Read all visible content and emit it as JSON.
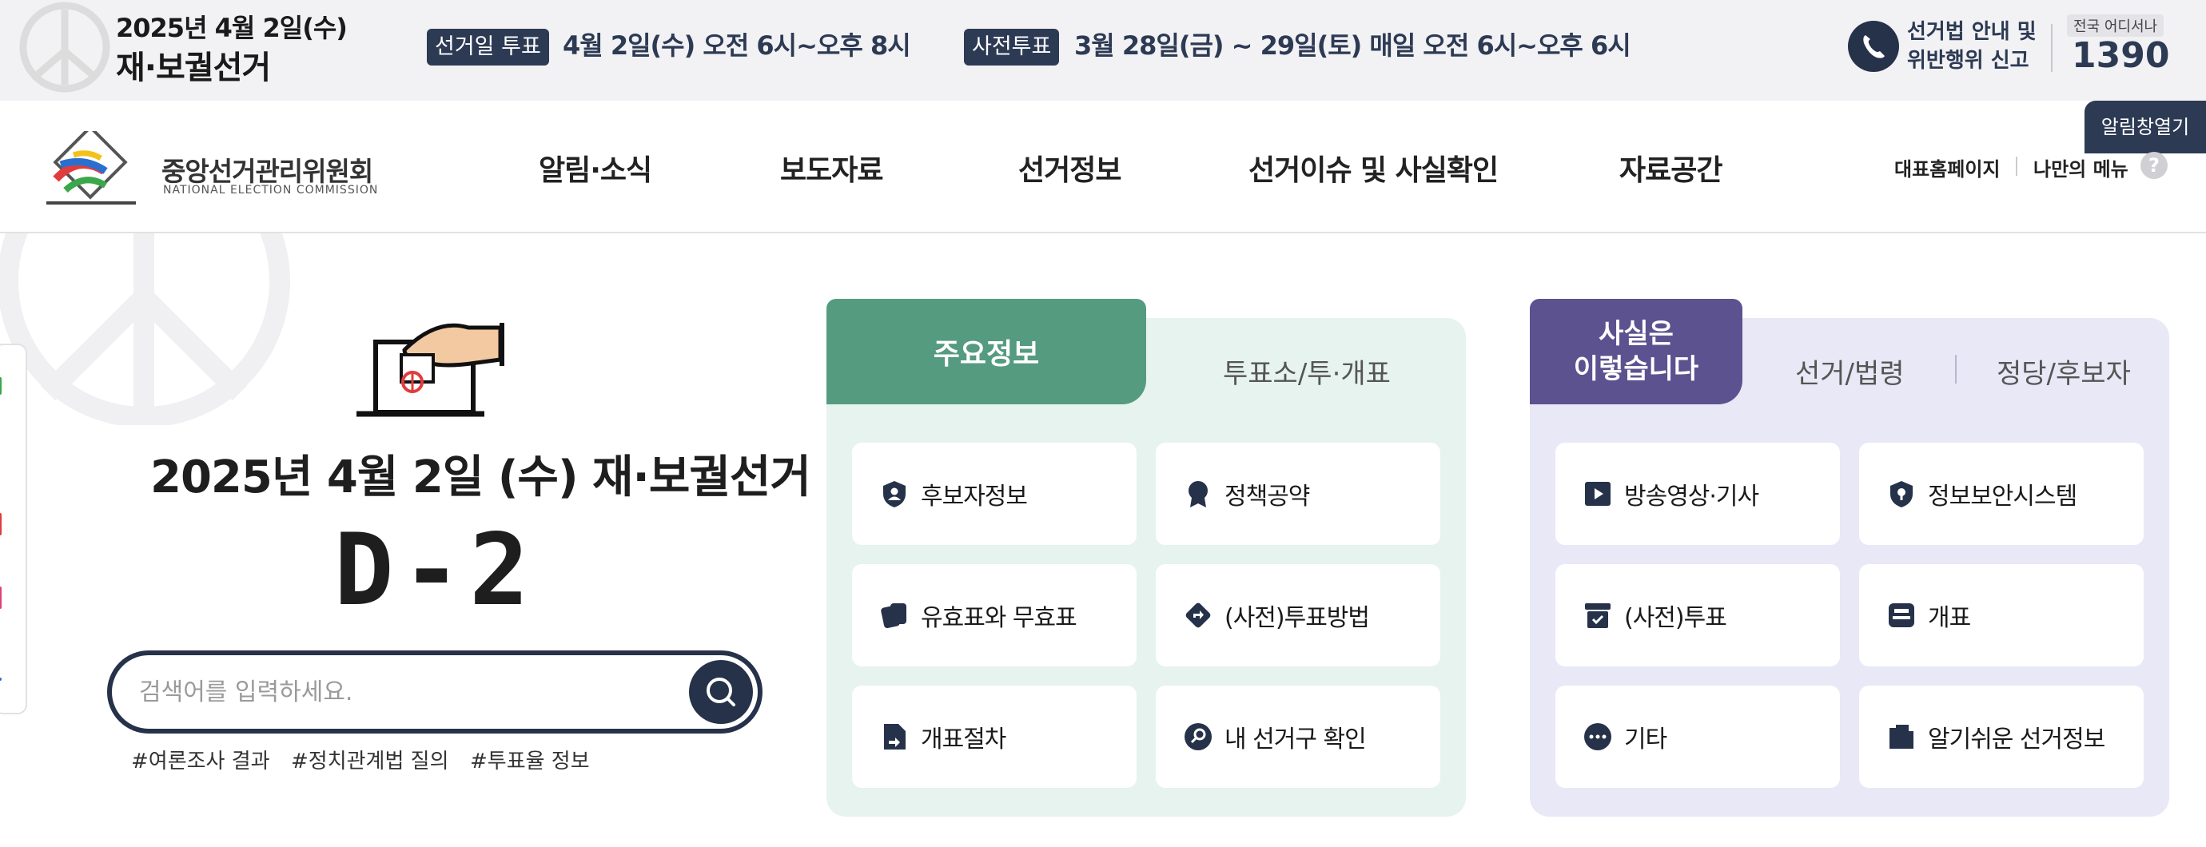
{
  "banner": {
    "date": "2025년 4월 2일(수)",
    "title": "재·보궐선거",
    "election_day_badge": "선거일 투표",
    "election_day_time": "4월 2일(수) 오전 6시~오후 8시",
    "early_vote_badge": "사전투표",
    "early_vote_time": "3월 28일(금) ~ 29일(토) 매일 오전 6시~오후 6시",
    "report_line1": "선거법 안내 및",
    "report_line2": "위반행위 신고",
    "anywhere": "전국 어디서나",
    "hotline": "1390",
    "alarm_button": "알림창열기"
  },
  "logo": {
    "kr": "중앙선거관리위원회",
    "en": "NATIONAL ELECTION COMMISSION"
  },
  "nav": {
    "items": [
      "알림·소식",
      "보도자료",
      "선거정보",
      "선거이슈 및 사실확인",
      "자료공간"
    ],
    "home": "대표홈페이지",
    "my_menu": "나만의 메뉴",
    "help": "?"
  },
  "hero": {
    "title": "2025년 4월 2일 (수) 재·보궐선거",
    "dday": "D-2",
    "search_placeholder": "검색어를 입력하세요.",
    "tags": [
      "#여론조사 결과",
      "#정치관계법 질의",
      "#투표율 정보"
    ]
  },
  "main_info": {
    "active_tab": "주요정보",
    "other_tab": "투표소/투·개표",
    "cards": [
      {
        "label": "후보자정보",
        "icon": "shield-person-icon"
      },
      {
        "label": "정책공약",
        "icon": "medal-icon"
      },
      {
        "label": "유효표와 무효표",
        "icon": "cards-icon"
      },
      {
        "label": "(사전)투표방법",
        "icon": "direction-icon"
      },
      {
        "label": "개표절차",
        "icon": "document-arrow-icon"
      },
      {
        "label": "내 선거구 확인",
        "icon": "search-circle-icon"
      }
    ]
  },
  "facts": {
    "active_tab_line1": "사실은",
    "active_tab_line2": "이렇습니다",
    "tab2": "선거/법령",
    "tab3": "정당/후보자",
    "cards": [
      {
        "label": "방송영상·기사",
        "icon": "play-icon"
      },
      {
        "label": "정보보안시스템",
        "icon": "security-shield-icon"
      },
      {
        "label": "(사전)투표",
        "icon": "ballot-box-icon"
      },
      {
        "label": "개표",
        "icon": "counting-machine-icon"
      },
      {
        "label": "기타",
        "icon": "more-icon"
      },
      {
        "label": "알기쉬운 선거정보",
        "icon": "folder-icon"
      }
    ]
  },
  "colors": {
    "navy": "#2d3a54",
    "green_tab": "#559b80",
    "green_panel": "#e6f3ee",
    "purple_tab": "#5d5290",
    "purple_panel": "#e8e8f6"
  }
}
